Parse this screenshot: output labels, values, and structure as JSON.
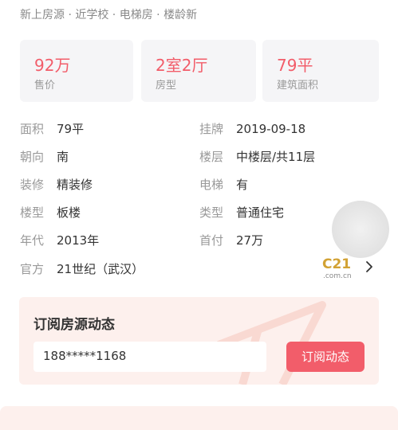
{
  "tags": [
    "新上房源",
    "近学校",
    "电梯房",
    "楼龄新"
  ],
  "tag_separator": " · ",
  "stats": [
    {
      "value": "92万",
      "label": "售价"
    },
    {
      "value": "2室2厅",
      "label": "房型"
    },
    {
      "value": "79平",
      "label": "建筑面积"
    }
  ],
  "details": {
    "left": [
      {
        "key": "面积",
        "value": "79平"
      },
      {
        "key": "朝向",
        "value": "南"
      },
      {
        "key": "装修",
        "value": "精装修"
      },
      {
        "key": "楼型",
        "value": "板楼"
      },
      {
        "key": "年代",
        "value": "2013年"
      },
      {
        "key": "官方",
        "value": "21世纪（武汉）"
      }
    ],
    "right": [
      {
        "key": "挂牌",
        "value": "2019-09-18"
      },
      {
        "key": "楼层",
        "value": "中楼层/共11层"
      },
      {
        "key": "电梯",
        "value": "有"
      },
      {
        "key": "类型",
        "value": "普通住宅"
      },
      {
        "key": "首付",
        "value": "27万"
      }
    ]
  },
  "agency_logo": {
    "big": "C21",
    "small": ".com.cn"
  },
  "subscribe": {
    "title": "订阅房源动态",
    "phone": "188*****1168",
    "button": "订阅动态"
  },
  "colors": {
    "accent": "#f25d6a",
    "card_bg": "#f5f5f7",
    "subscribe_bg": "#fdf0ed"
  }
}
